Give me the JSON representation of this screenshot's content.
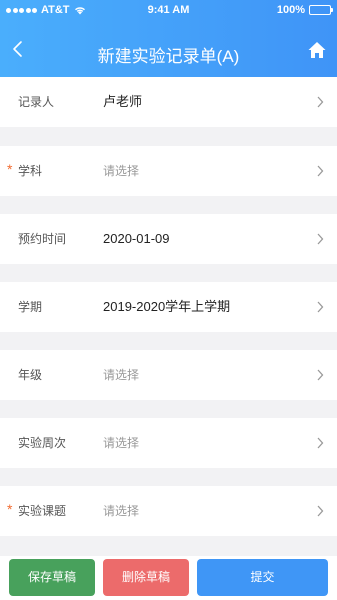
{
  "status_bar": {
    "carrier": "AT&T",
    "time": "9:41 AM",
    "battery": "100%"
  },
  "header": {
    "title": "新建实验记录单(A)",
    "back_icon": "chevron-left-icon",
    "home_icon": "home-icon"
  },
  "form": {
    "rows": [
      {
        "label": "记录人",
        "value": "卢老师",
        "required": false,
        "placeholder": false
      },
      {
        "label": "学科",
        "value": "请选择",
        "required": true,
        "placeholder": true
      },
      {
        "label": "预约时间",
        "value": "2020-01-09",
        "required": false,
        "placeholder": false
      },
      {
        "label": "学期",
        "value": "2019-2020学年上学期",
        "required": false,
        "placeholder": false
      },
      {
        "label": "年级",
        "value": "请选择",
        "required": false,
        "placeholder": true
      },
      {
        "label": "实验周次",
        "value": "请选择",
        "required": false,
        "placeholder": true
      },
      {
        "label": "实验课题",
        "value": "请选择",
        "required": true,
        "placeholder": true
      }
    ],
    "required_mark": "*"
  },
  "buttons": {
    "save": "保存草稿",
    "delete": "删除草稿",
    "submit": "提交"
  },
  "colors": {
    "header_gradient_start": "#4aaefc",
    "header_gradient_end": "#3f94f7",
    "required": "#f26b2f",
    "save": "#48a15c",
    "delete": "#ec6b6b",
    "submit": "#3f96f6"
  }
}
